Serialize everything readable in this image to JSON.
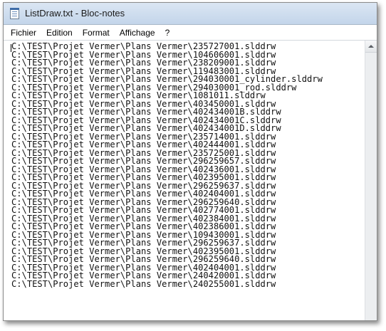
{
  "window": {
    "title": "ListDraw.txt - Bloc-notes"
  },
  "menu": {
    "items": [
      {
        "label": "Fichier"
      },
      {
        "label": "Edition"
      },
      {
        "label": "Format"
      },
      {
        "label": "Affichage"
      },
      {
        "label": "?"
      }
    ]
  },
  "editor": {
    "lines": [
      "C:\\TEST\\Projet Vermer\\Plans Vermer\\235727001.slddrw",
      "C:\\TEST\\Projet Vermer\\Plans Vermer\\104606001.slddrw",
      "C:\\TEST\\Projet Vermer\\Plans Vermer\\238209001.slddrw",
      "C:\\TEST\\Projet Vermer\\Plans Vermer\\119483001.slddrw",
      "C:\\TEST\\Projet Vermer\\Plans Vermer\\294030001_cylinder.slddrw",
      "C:\\TEST\\Projet Vermer\\Plans Vermer\\294030001_rod.slddrw",
      "C:\\TEST\\Projet Vermer\\Plans Vermer\\1081011.slddrw",
      "C:\\TEST\\Projet Vermer\\Plans Vermer\\403450001.slddrw",
      "C:\\TEST\\Projet Vermer\\Plans Vermer\\402434001B.slddrw",
      "C:\\TEST\\Projet Vermer\\Plans Vermer\\402434001C.slddrw",
      "C:\\TEST\\Projet Vermer\\Plans Vermer\\402434001D.slddrw",
      "C:\\TEST\\Projet Vermer\\Plans Vermer\\235714001.slddrw",
      "C:\\TEST\\Projet Vermer\\Plans Vermer\\402444001.slddrw",
      "C:\\TEST\\Projet Vermer\\Plans Vermer\\235725001.slddrw",
      "C:\\TEST\\Projet Vermer\\Plans Vermer\\296259657.slddrw",
      "C:\\TEST\\Projet Vermer\\Plans Vermer\\402436001.slddrw",
      "C:\\TEST\\Projet Vermer\\Plans Vermer\\402395001.slddrw",
      "C:\\TEST\\Projet Vermer\\Plans Vermer\\296259637.slddrw",
      "C:\\TEST\\Projet Vermer\\Plans Vermer\\402404001.slddrw",
      "C:\\TEST\\Projet Vermer\\Plans Vermer\\296259640.slddrw",
      "C:\\TEST\\Projet Vermer\\Plans Vermer\\402774001.slddrw",
      "C:\\TEST\\Projet Vermer\\Plans Vermer\\402384001.slddrw",
      "C:\\TEST\\Projet Vermer\\Plans Vermer\\402386001.slddrw",
      "C:\\TEST\\Projet Vermer\\Plans Vermer\\109430001.slddrw",
      "C:\\TEST\\Projet Vermer\\Plans Vermer\\296259637.slddrw",
      "C:\\TEST\\Projet Vermer\\Plans Vermer\\402395001.slddrw",
      "C:\\TEST\\Projet Vermer\\Plans Vermer\\296259640.slddrw",
      "C:\\TEST\\Projet Vermer\\Plans Vermer\\402404001.slddrw",
      "C:\\TEST\\Projet Vermer\\Plans Vermer\\240420001.slddrw",
      "C:\\TEST\\Projet Vermer\\Plans Vermer\\240255001.slddrw"
    ]
  }
}
